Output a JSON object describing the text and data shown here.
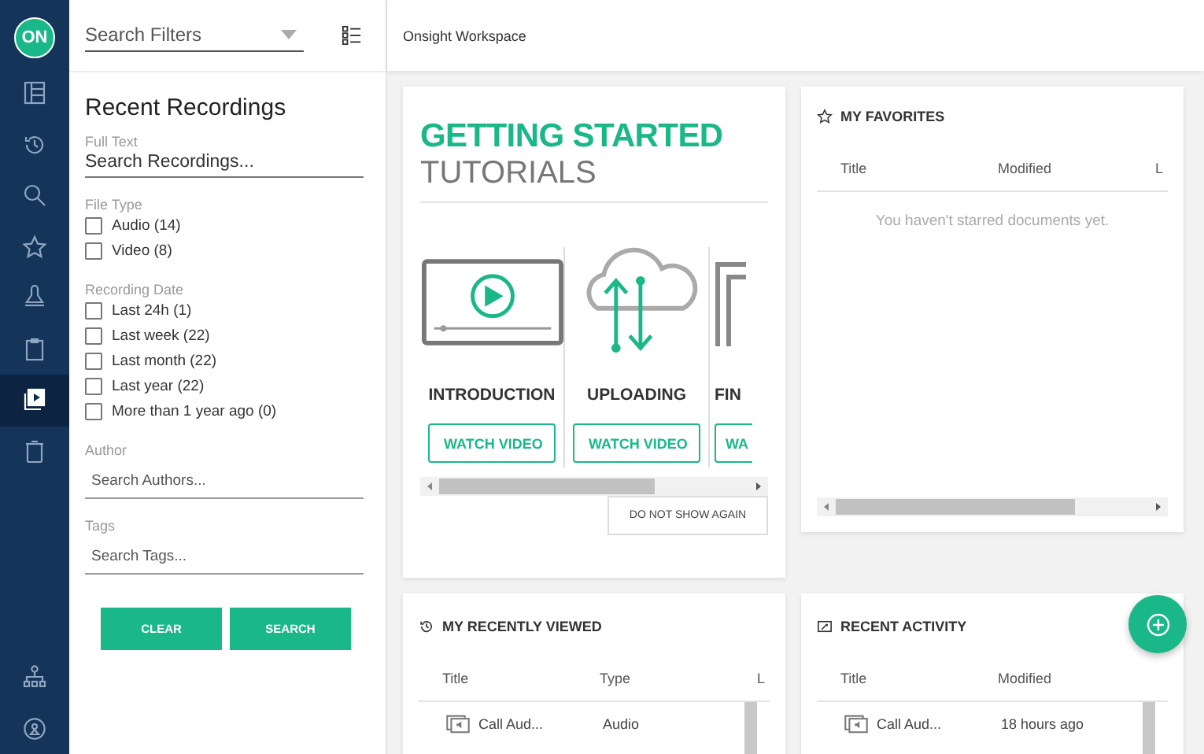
{
  "rail": {
    "logo": "ON",
    "items": [
      {
        "kind": "tree",
        "selected": false
      },
      {
        "kind": "history",
        "selected": false
      },
      {
        "kind": "search",
        "selected": false
      },
      {
        "kind": "star",
        "selected": false
      },
      {
        "kind": "bell",
        "selected": false
      },
      {
        "kind": "clipboard",
        "selected": false
      },
      {
        "kind": "media",
        "selected": true
      },
      {
        "kind": "trash",
        "selected": false
      }
    ],
    "bottom": [
      {
        "kind": "hierarchy"
      },
      {
        "kind": "badge"
      }
    ]
  },
  "filters": {
    "dropdown": {
      "placeholder": "Search Filters"
    },
    "title": "Recent Recordings",
    "full_text": {
      "label": "Full Text",
      "placeholder": "Search Recordings..."
    },
    "groups": [
      {
        "label": "File Type",
        "options": [
          {
            "label": "Audio (14)",
            "checked": false
          },
          {
            "label": "Video (8)",
            "checked": false
          }
        ]
      },
      {
        "label": "Recording Date",
        "options": [
          {
            "label": "Last 24h (1)",
            "checked": false
          },
          {
            "label": "Last week (22)",
            "checked": false
          },
          {
            "label": "Last month (22)",
            "checked": false
          },
          {
            "label": "Last year (22)",
            "checked": false
          },
          {
            "label": "More than 1 year ago (0)",
            "checked": false
          }
        ]
      }
    ],
    "fields": [
      {
        "label": "Author",
        "placeholder": "Search Authors..."
      },
      {
        "label": "Tags",
        "placeholder": "Search Tags..."
      }
    ],
    "buttons": [
      "CLEAR",
      "SEARCH"
    ]
  },
  "header": {
    "title": "Onsight Workspace"
  },
  "getting_started": {
    "title": "GETTING STARTED",
    "subtitle": "TUTORIALS",
    "tutorials": [
      {
        "kind": "video",
        "title": "INTRODUCTION",
        "button": "WATCH VIDEO"
      },
      {
        "kind": "upload",
        "title": "UPLOADING",
        "button": "WATCH VIDEO"
      },
      {
        "kind": "find",
        "title": "FIN",
        "button": "WA"
      }
    ],
    "dismiss": "DO NOT SHOW AGAIN"
  },
  "favorites": {
    "title": "MY FAVORITES",
    "columns": [
      "Title",
      "Modified",
      "L"
    ],
    "empty": "You haven't starred documents yet."
  },
  "recently_viewed": {
    "title": "MY RECENTLY VIEWED",
    "columns": [
      "Title",
      "Type",
      "L"
    ],
    "rows": [
      [
        "Call Aud...",
        "Audio"
      ]
    ]
  },
  "recent_activity": {
    "title": "RECENT ACTIVITY",
    "columns": [
      "Title",
      "Modified"
    ],
    "rows": [
      [
        "Call Aud...",
        "18 hours ago"
      ]
    ]
  }
}
